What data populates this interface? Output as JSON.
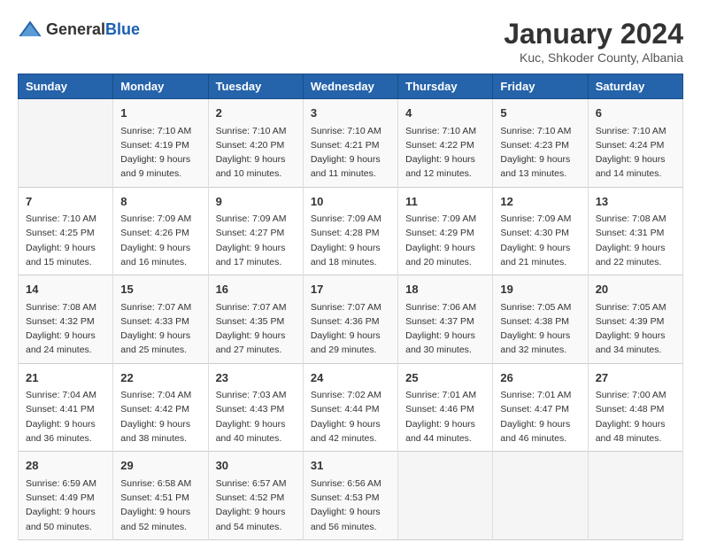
{
  "header": {
    "logo_general": "General",
    "logo_blue": "Blue",
    "month_year": "January 2024",
    "location": "Kuc, Shkoder County, Albania"
  },
  "days_of_week": [
    "Sunday",
    "Monday",
    "Tuesday",
    "Wednesday",
    "Thursday",
    "Friday",
    "Saturday"
  ],
  "weeks": [
    [
      {
        "day": "",
        "info": ""
      },
      {
        "day": "1",
        "info": "Sunrise: 7:10 AM\nSunset: 4:19 PM\nDaylight: 9 hours\nand 9 minutes."
      },
      {
        "day": "2",
        "info": "Sunrise: 7:10 AM\nSunset: 4:20 PM\nDaylight: 9 hours\nand 10 minutes."
      },
      {
        "day": "3",
        "info": "Sunrise: 7:10 AM\nSunset: 4:21 PM\nDaylight: 9 hours\nand 11 minutes."
      },
      {
        "day": "4",
        "info": "Sunrise: 7:10 AM\nSunset: 4:22 PM\nDaylight: 9 hours\nand 12 minutes."
      },
      {
        "day": "5",
        "info": "Sunrise: 7:10 AM\nSunset: 4:23 PM\nDaylight: 9 hours\nand 13 minutes."
      },
      {
        "day": "6",
        "info": "Sunrise: 7:10 AM\nSunset: 4:24 PM\nDaylight: 9 hours\nand 14 minutes."
      }
    ],
    [
      {
        "day": "7",
        "info": ""
      },
      {
        "day": "8",
        "info": "Sunrise: 7:09 AM\nSunset: 4:26 PM\nDaylight: 9 hours\nand 16 minutes."
      },
      {
        "day": "9",
        "info": "Sunrise: 7:09 AM\nSunset: 4:27 PM\nDaylight: 9 hours\nand 17 minutes."
      },
      {
        "day": "10",
        "info": "Sunrise: 7:09 AM\nSunset: 4:28 PM\nDaylight: 9 hours\nand 18 minutes."
      },
      {
        "day": "11",
        "info": "Sunrise: 7:09 AM\nSunset: 4:29 PM\nDaylight: 9 hours\nand 20 minutes."
      },
      {
        "day": "12",
        "info": "Sunrise: 7:09 AM\nSunset: 4:30 PM\nDaylight: 9 hours\nand 21 minutes."
      },
      {
        "day": "13",
        "info": "Sunrise: 7:08 AM\nSunset: 4:31 PM\nDaylight: 9 hours\nand 22 minutes."
      }
    ],
    [
      {
        "day": "14",
        "info": ""
      },
      {
        "day": "15",
        "info": "Sunrise: 7:07 AM\nSunset: 4:33 PM\nDaylight: 9 hours\nand 25 minutes."
      },
      {
        "day": "16",
        "info": "Sunrise: 7:07 AM\nSunset: 4:35 PM\nDaylight: 9 hours\nand 27 minutes."
      },
      {
        "day": "17",
        "info": "Sunrise: 7:07 AM\nSunset: 4:36 PM\nDaylight: 9 hours\nand 29 minutes."
      },
      {
        "day": "18",
        "info": "Sunrise: 7:06 AM\nSunset: 4:37 PM\nDaylight: 9 hours\nand 30 minutes."
      },
      {
        "day": "19",
        "info": "Sunrise: 7:05 AM\nSunset: 4:38 PM\nDaylight: 9 hours\nand 32 minutes."
      },
      {
        "day": "20",
        "info": "Sunrise: 7:05 AM\nSunset: 4:39 PM\nDaylight: 9 hours\nand 34 minutes."
      }
    ],
    [
      {
        "day": "21",
        "info": ""
      },
      {
        "day": "22",
        "info": "Sunrise: 7:04 AM\nSunset: 4:42 PM\nDaylight: 9 hours\nand 38 minutes."
      },
      {
        "day": "23",
        "info": "Sunrise: 7:03 AM\nSunset: 4:43 PM\nDaylight: 9 hours\nand 40 minutes."
      },
      {
        "day": "24",
        "info": "Sunrise: 7:02 AM\nSunset: 4:44 PM\nDaylight: 9 hours\nand 42 minutes."
      },
      {
        "day": "25",
        "info": "Sunrise: 7:01 AM\nSunset: 4:46 PM\nDaylight: 9 hours\nand 44 minutes."
      },
      {
        "day": "26",
        "info": "Sunrise: 7:01 AM\nSunset: 4:47 PM\nDaylight: 9 hours\nand 46 minutes."
      },
      {
        "day": "27",
        "info": "Sunrise: 7:00 AM\nSunset: 4:48 PM\nDaylight: 9 hours\nand 48 minutes."
      }
    ],
    [
      {
        "day": "28",
        "info": "Sunrise: 6:59 AM\nSunset: 4:49 PM\nDaylight: 9 hours\nand 50 minutes."
      },
      {
        "day": "29",
        "info": "Sunrise: 6:58 AM\nSunset: 4:51 PM\nDaylight: 9 hours\nand 52 minutes."
      },
      {
        "day": "30",
        "info": "Sunrise: 6:57 AM\nSunset: 4:52 PM\nDaylight: 9 hours\nand 54 minutes."
      },
      {
        "day": "31",
        "info": "Sunrise: 6:56 AM\nSunset: 4:53 PM\nDaylight: 9 hours\nand 56 minutes."
      },
      {
        "day": "",
        "info": ""
      },
      {
        "day": "",
        "info": ""
      },
      {
        "day": "",
        "info": ""
      }
    ]
  ],
  "week1_sunday_info": "Sunrise: 7:10 AM\nSunset: 4:25 PM\nDaylight: 9 hours\nand 15 minutes.",
  "week2_sunday_info": "Sunrise: 7:08 AM\nSunset: 4:32 PM\nDaylight: 9 hours\nand 24 minutes.",
  "week3_sunday_info": "Sunrise: 7:04 AM\nSunset: 4:41 PM\nDaylight: 9 hours\nand 36 minutes."
}
